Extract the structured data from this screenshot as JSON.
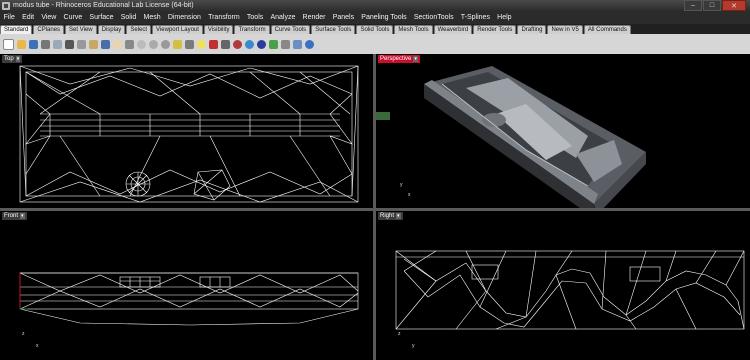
{
  "window": {
    "title": "modus tube - Rhinoceros Educational Lab License (64-bit)"
  },
  "menu": [
    "File",
    "Edit",
    "View",
    "Curve",
    "Surface",
    "Solid",
    "Mesh",
    "Dimension",
    "Transform",
    "Tools",
    "Analyze",
    "Render",
    "Panels",
    "Paneling Tools",
    "SectionTools",
    "T-Splines",
    "Help"
  ],
  "tabs": [
    "Standard",
    "CPlanes",
    "Set View",
    "Display",
    "Select",
    "Viewport Layout",
    "Visibility",
    "Transform",
    "Curve Tools",
    "Surface Tools",
    "Solid Tools",
    "Mesh Tools",
    "Weaverbird",
    "Render Tools",
    "Drafting",
    "New in V5",
    "All Commands"
  ],
  "viewports": [
    {
      "label": "Top",
      "active": false,
      "axis_v": "y",
      "axis_h": "x"
    },
    {
      "label": "Perspective",
      "active": true,
      "axis_v": "y",
      "axis_h": "x"
    },
    {
      "label": "Front",
      "active": false,
      "axis_v": "z",
      "axis_h": "x"
    },
    {
      "label": "Right",
      "active": false,
      "axis_v": "z",
      "axis_h": "y"
    }
  ],
  "colors": {
    "active_viewport": "#c8102e",
    "wireframe": "#ffffff",
    "viewport_bg": "#000000",
    "model_surface": "#6e7279"
  },
  "icons": [
    "new-file-icon",
    "open-icon",
    "save-icon",
    "print-icon",
    "import-icon",
    "cut-icon",
    "copy-icon",
    "paste-icon",
    "undo-icon",
    "pan-icon",
    "rotate-icon",
    "zoom-icon",
    "zoom-window-icon",
    "zoom-extents-icon",
    "select-icon",
    "grid-icon",
    "light-icon",
    "render-icon",
    "shade-icon",
    "material-icon",
    "color-icon",
    "sphere-icon",
    "layer-icon",
    "properties-icon",
    "options-icon",
    "help-icon"
  ]
}
